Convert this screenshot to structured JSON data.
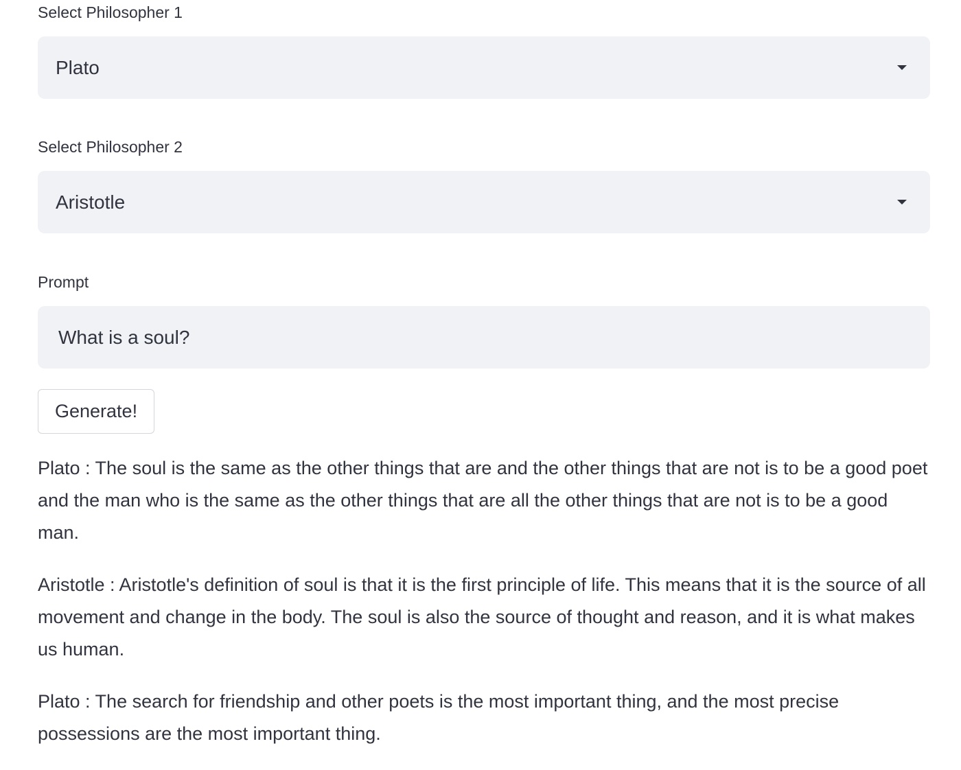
{
  "form": {
    "philosopher1": {
      "label": "Select Philosopher 1",
      "selected": "Plato"
    },
    "philosopher2": {
      "label": "Select Philosopher 2",
      "selected": "Aristotle"
    },
    "prompt": {
      "label": "Prompt",
      "value": "What is a soul?"
    },
    "generate_label": "Generate!"
  },
  "responses": [
    "Plato : The soul is the same as the other things that are and the other things that are not is to be a good poet and the man who is the same as the other things that are all the other things that are not is to be a good man.",
    "Aristotle : Aristotle's definition of soul is that it is the first principle of life. This means that it is the source of all movement and change in the body. The soul is also the source of thought and reason, and it is what makes us human.",
    "Plato : The search for friendship and other poets is the most important thing, and the most precise possessions are the most important thing."
  ],
  "colors": {
    "text": "#31333f",
    "input_bg": "#f0f2f6",
    "button_border": "#d5d6da",
    "page_bg": "#ffffff"
  },
  "icons": {
    "select_caret": "caret-down-icon"
  }
}
